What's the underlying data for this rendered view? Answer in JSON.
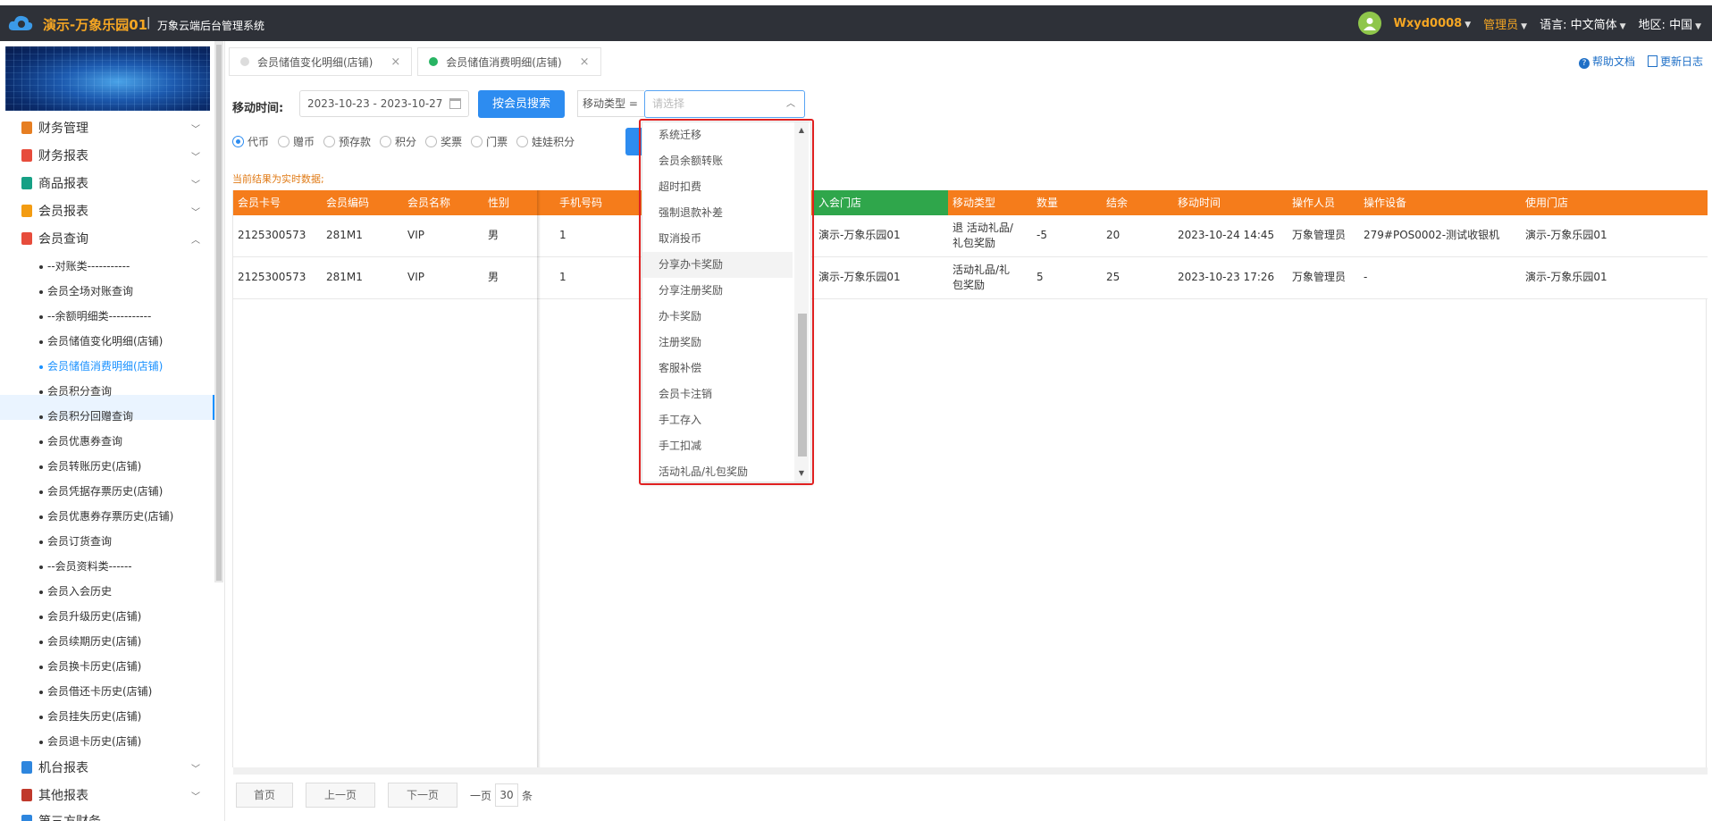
{
  "header": {
    "brand": "演示-万象乐园01",
    "separator": "|",
    "system_name": "万象云端后台管理系统",
    "username": "Wxyd0008",
    "role": "管理员",
    "language_label": "语言:",
    "language_value": "中文简体",
    "region_label": "地区:",
    "region_value": "中国",
    "icons": [
      "cloud-logo-icon",
      "user-avatar-icon",
      "chevron-down-icon"
    ]
  },
  "sidebar": {
    "menus": [
      {
        "label": "财务管理",
        "icon_color": "#e67e22"
      },
      {
        "label": "财务报表",
        "icon_color": "#e74c3c"
      },
      {
        "label": "商品报表",
        "icon_color": "#16a085"
      },
      {
        "label": "会员报表",
        "icon_color": "#f39c12"
      },
      {
        "label": "会员查询",
        "icon_color": "#e74c3c"
      }
    ],
    "sub_items": [
      "--对账类-----------",
      "会员全场对账查询",
      "--余额明细类-----------",
      "会员储值变化明细(店铺)",
      "会员储值消费明细(店铺)",
      "会员积分查询",
      "会员积分回赠查询",
      "会员优惠券查询",
      "会员转账历史(店铺)",
      "会员凭据存票历史(店铺)",
      "会员优惠券存票历史(店铺)",
      "会员订货查询",
      "--会员资料类------",
      "会员入会历史",
      "会员升级历史(店铺)",
      "会员续期历史(店铺)",
      "会员换卡历史(店铺)",
      "会员借还卡历史(店铺)",
      "会员挂失历史(店铺)",
      "会员退卡历史(店铺)"
    ],
    "bottom_menus": [
      {
        "label": "机台报表",
        "icon_color": "#2e86de"
      },
      {
        "label": "其他报表",
        "icon_color": "#c0392b"
      },
      {
        "label": "第三方财务",
        "icon_color": "#2e86de"
      }
    ]
  },
  "tabs": [
    {
      "label": "会员储值变化明细(店铺)",
      "close": "×"
    },
    {
      "label": "会员储值消费明细(店铺)",
      "close": "×"
    }
  ],
  "help": {
    "doc": "帮助文档",
    "log": "更新日志"
  },
  "search": {
    "time_label": "移动时间:",
    "date_range": "2023-10-23 - 2023-10-27",
    "search_button": "按会员搜索",
    "type_label": "移动类型 =",
    "type_placeholder": "请选择"
  },
  "radios": [
    {
      "label": "代币",
      "checked": true
    },
    {
      "label": "赠币",
      "checked": false
    },
    {
      "label": "预存款",
      "checked": false
    },
    {
      "label": "积分",
      "checked": false
    },
    {
      "label": "奖票",
      "checked": false
    },
    {
      "label": "门票",
      "checked": false
    },
    {
      "label": "娃娃积分",
      "checked": false
    }
  ],
  "realtime_note": "当前结果为实时数据;",
  "table": {
    "headers": [
      "会员卡号",
      "会员编码",
      "会员名称",
      "性别",
      "手机号码",
      "入会门店",
      "移动类型",
      "数量",
      "结余",
      "移动时间",
      "操作人员",
      "操作设备",
      "使用门店"
    ],
    "rows": [
      [
        "2125300573",
        "281M1",
        "VIP",
        "男",
        "1",
        "演示-万象乐园01",
        "退 活动礼品/礼包奖励",
        "-5",
        "20",
        "2023-10-24 14:45",
        "万象管理员",
        "279#POS0002-测试收银机",
        "演示-万象乐园01"
      ],
      [
        "2125300573",
        "281M1",
        "VIP",
        "男",
        "1",
        "演示-万象乐园01",
        "活动礼品/礼包奖励",
        "5",
        "25",
        "2023-10-23 17:26",
        "万象管理员",
        "-",
        "演示-万象乐园01"
      ]
    ]
  },
  "pager": {
    "first": "首页",
    "prev": "上一页",
    "next": "下一页",
    "per_page_label": "一页",
    "per_page_value": "30",
    "unit": "条"
  },
  "dropdown": {
    "options": [
      "系统迁移",
      "会员余额转账",
      "超时扣费",
      "强制退款补差",
      "取消投币",
      "分享办卡奖励",
      "分享注册奖励",
      "办卡奖励",
      "注册奖励",
      "客服补偿",
      "会员卡注销",
      "手工存入",
      "手工扣减",
      "活动礼品/礼包奖励"
    ],
    "hovered": "分享办卡奖励"
  }
}
